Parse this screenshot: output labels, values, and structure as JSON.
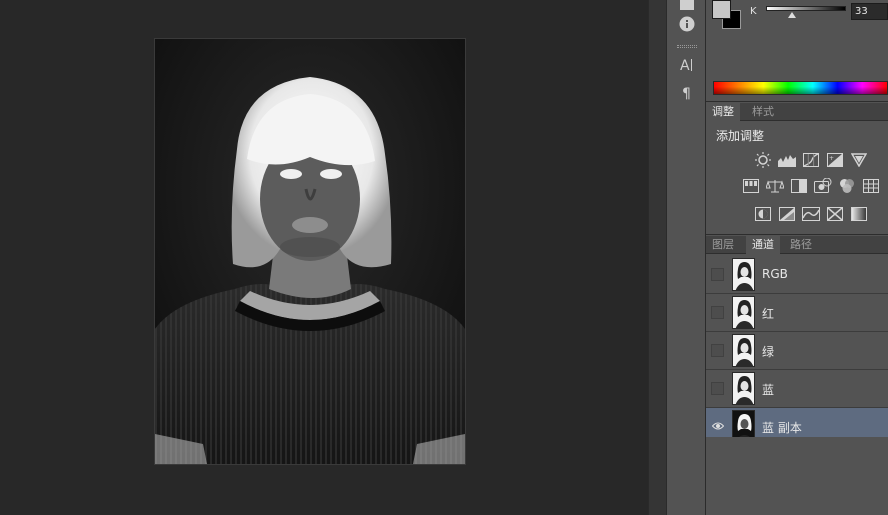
{
  "color_panel": {
    "channel_label": "K",
    "value": "33"
  },
  "adjustments_panel": {
    "tabs": [
      {
        "label": "调整",
        "active": true
      },
      {
        "label": "样式",
        "active": false
      }
    ],
    "title": "添加调整",
    "icons_row1": [
      "brightness-contrast-icon",
      "levels-icon",
      "curves-icon",
      "exposure-icon",
      "vibrance-icon"
    ],
    "icons_row2": [
      "hue-saturation-icon",
      "color-balance-icon",
      "black-white-icon",
      "photo-filter-icon",
      "channel-mixer-icon",
      "color-lookup-icon"
    ],
    "icons_row3": [
      "invert-icon",
      "posterize-icon",
      "threshold-icon",
      "selective-color-icon",
      "gradient-map-icon"
    ]
  },
  "layers_panel": {
    "tabs": [
      {
        "label": "图层",
        "active": false
      },
      {
        "label": "通道",
        "active": true
      },
      {
        "label": "路径",
        "active": false
      }
    ],
    "channels": [
      {
        "name": "RGB",
        "visible": false,
        "selected": false,
        "inverted": false
      },
      {
        "name": "红",
        "visible": false,
        "selected": false,
        "inverted": false
      },
      {
        "name": "绿",
        "visible": false,
        "selected": false,
        "inverted": false
      },
      {
        "name": "蓝",
        "visible": false,
        "selected": false,
        "inverted": false
      },
      {
        "name": "蓝 副本",
        "visible": true,
        "selected": true,
        "inverted": true
      }
    ]
  },
  "tool_column": {
    "icons": [
      "histogram-icon",
      "info-icon",
      "character-icon",
      "paragraph-icon"
    ]
  },
  "colors": {
    "canvas_bg": "#282828",
    "panel_bg": "#535353",
    "selection": "#5e6b80"
  }
}
